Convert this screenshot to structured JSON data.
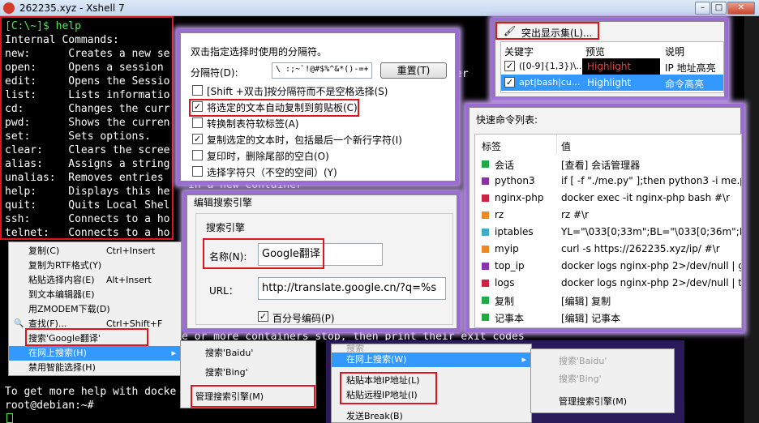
{
  "window": {
    "title": "262235.xyz - Xshell 7"
  },
  "terminal": {
    "lines": [
      {
        "text": "[C:\\~]$ help",
        "cls": "green"
      },
      {
        "text": "Internal Commands:",
        "cls": ""
      },
      {
        "text": "new:      Creates a new se",
        "cls": ""
      },
      {
        "text": "open:     Opens a session",
        "cls": ""
      },
      {
        "text": "edit:     Opens the Sessio",
        "cls": ""
      },
      {
        "text": "list:     Lists informatio",
        "cls": ""
      },
      {
        "text": "cd:       Changes the curr",
        "cls": ""
      },
      {
        "text": "pwd:      Shows the curren",
        "cls": ""
      },
      {
        "text": "set:      Sets options.",
        "cls": ""
      },
      {
        "text": "clear:    Clears the scree",
        "cls": ""
      },
      {
        "text": "alias:    Assigns a string",
        "cls": ""
      },
      {
        "text": "unalias:  Removes entries",
        "cls": ""
      },
      {
        "text": "help:     Displays this he",
        "cls": ""
      },
      {
        "text": "quit:     Quits Local Shel",
        "cls": ""
      },
      {
        "text": "ssh:      Connects to a ho",
        "cls": ""
      },
      {
        "text": "telnet:   Connects to a ho",
        "cls": ""
      }
    ],
    "fragment_er": "er",
    "fragment_container": "in a new container",
    "fragment_exit": "e or more containers stop, then print their exit codes",
    "help_line": "To get more help with docke",
    "prompt": "root@debian:~#"
  },
  "delimiter_panel": {
    "title": "双击指定选择时使用的分隔符。",
    "label": "分隔符(D):",
    "value": "\\ :;~`!@#$%^&*()-=+",
    "reset": "重置(T)",
    "options": [
      {
        "label": "[Shift +双击]按分隔符而不是空格选择(S)",
        "checked": false
      },
      {
        "label": "将选定的文本自动复制到剪贴板(C)",
        "checked": true
      },
      {
        "label": "转换制表符软标签(A)",
        "checked": false
      },
      {
        "label": "复制选定的文本时，包括最后一个新行字符(I)",
        "checked": true
      },
      {
        "label": "复印时，删除尾部的空白(O)",
        "checked": false
      },
      {
        "label": "选择字符只（不空的空间）(Y)",
        "checked": false
      }
    ]
  },
  "highlight_panel": {
    "tab": "突出显示集(L)...",
    "headers": [
      "关键字",
      "预览",
      "说明"
    ],
    "rows": [
      {
        "key": "([0-9]{1,3})\\...",
        "preview": "Highlight",
        "desc": "IP 地址高亮"
      },
      {
        "key": "apt|bash|cu...",
        "preview": "Highlight",
        "desc": "命令高亮"
      }
    ]
  },
  "quick_panel": {
    "title": "快速命令列表:",
    "headers": [
      "标签",
      "值"
    ],
    "rows": [
      {
        "label": "会话",
        "value": "[查看] 会话管理器",
        "color": "#22aa44"
      },
      {
        "label": "python3",
        "value": "if [ -f \"./me.py\" ];then python3 -i me.py;",
        "color": "#8833aa"
      },
      {
        "label": "nginx-php",
        "value": "docker exec -it  nginx-php bash #\\r",
        "color": "#cc2244"
      },
      {
        "label": "rz",
        "value": "rz  #\\r",
        "color": "#ee8822"
      },
      {
        "label": "iptables",
        "value": "YL=\"\\033[0;33m\";BL=\"\\033[0;36m\";FT=\"",
        "color": "#44aacc"
      },
      {
        "label": "myip",
        "value": "curl -s https://262235.xyz/ip/   #\\r",
        "color": "#ee8822"
      },
      {
        "label": "top_ip",
        "value": "docker logs nginx-php 2>/dev/null | g",
        "color": "#8833aa"
      },
      {
        "label": "logs",
        "value": "docker logs nginx-php 2>/dev/null | ta",
        "color": "#cc2244"
      },
      {
        "label": "复制",
        "value": "[编辑] 复制",
        "color": "#22aa44"
      },
      {
        "label": "记事本",
        "value": "[编辑] 记事本",
        "color": "#22aa44"
      }
    ]
  },
  "search_engine_panel": {
    "title": "编辑搜索引擎",
    "group": "搜索引擎",
    "name_label": "名称(N):",
    "name_value": "Google翻译",
    "url_label": "URL：",
    "url_value": "http://translate.google.cn/?q=%s",
    "percent_label": "百分号编码(P)"
  },
  "context_menu": {
    "items": [
      {
        "label": "复制(C)",
        "shortcut": "Ctrl+Insert"
      },
      {
        "label": "复制为RTF格式(Y)",
        "shortcut": ""
      },
      {
        "label": "粘贴选择内容(E)",
        "shortcut": "Alt+Insert"
      },
      {
        "label": "到文本编辑器(E)",
        "shortcut": ""
      },
      {
        "label": "用ZMODEM下载(D)",
        "shortcut": ""
      },
      {
        "label": "查找(F)...",
        "shortcut": "Ctrl+Shift+F"
      },
      {
        "label": "搜索'Google翻译'",
        "shortcut": ""
      },
      {
        "label": "在网上搜索(H)",
        "shortcut": ""
      },
      {
        "label": "禁用智能选择(H)",
        "shortcut": ""
      }
    ]
  },
  "submenu1": {
    "items": [
      "搜索'Baidu'",
      "搜索'Bing'",
      "管理搜索引擎(M)"
    ]
  },
  "menu2": {
    "top": "搜索",
    "items": [
      "在网上搜索(W)",
      "粘贴本地IP地址(L)",
      "粘贴远程IP地址(I)",
      "发送Break(B)"
    ]
  },
  "submenu2": {
    "items": [
      "搜索'Baidu'",
      "搜索'Bing'",
      "管理搜索引擎(M)"
    ]
  }
}
